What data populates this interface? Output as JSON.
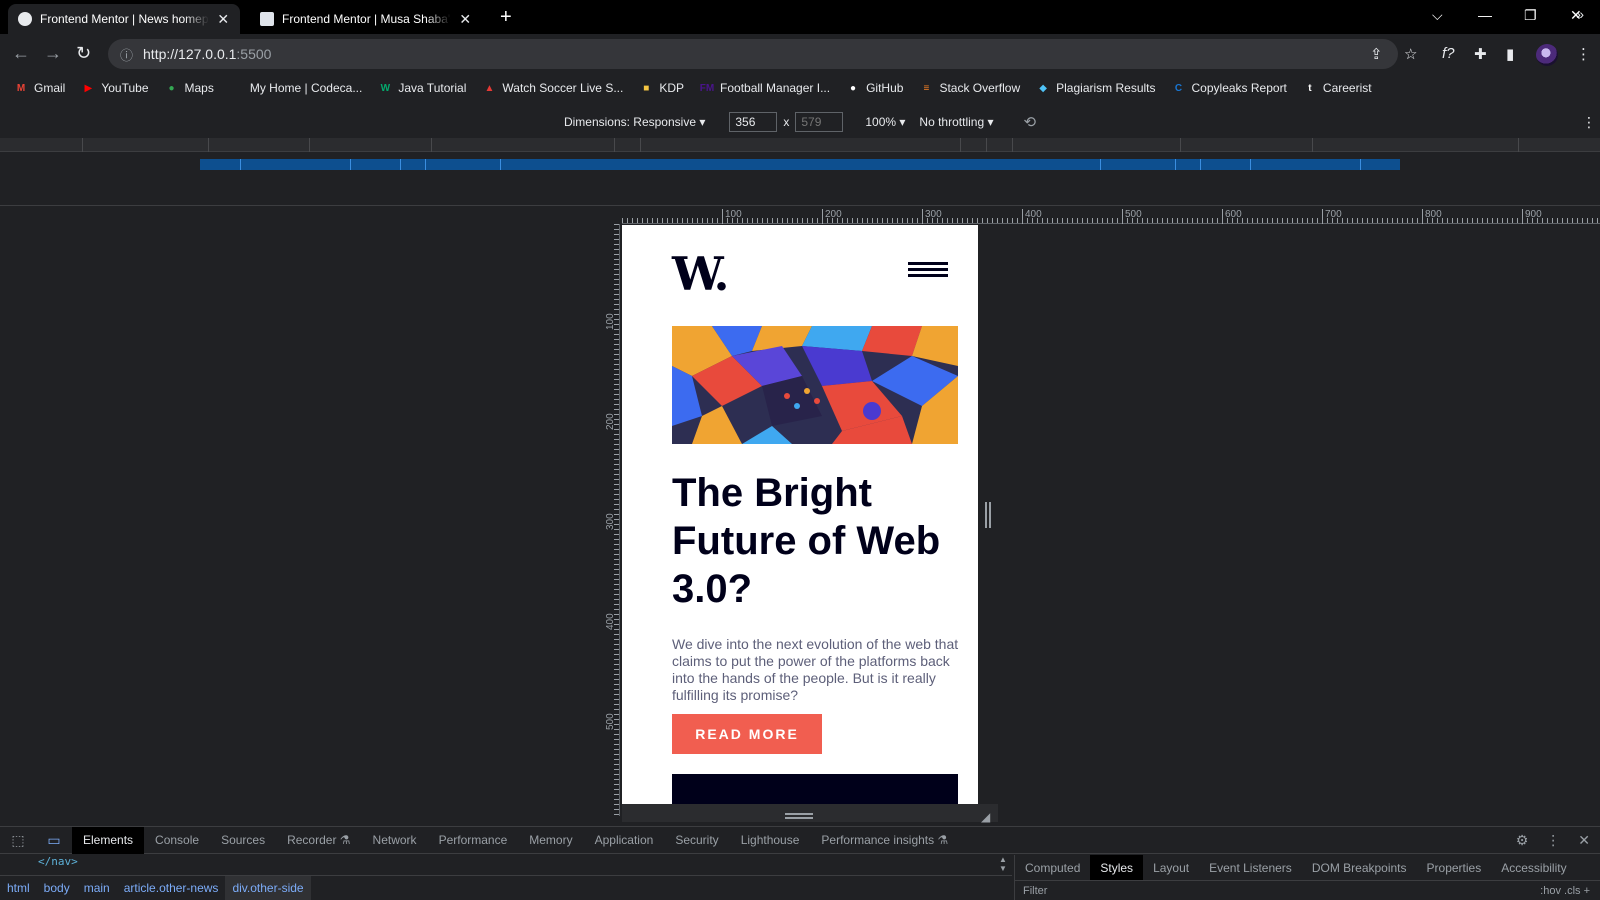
{
  "browser": {
    "tabs": [
      {
        "title": "Frontend Mentor | News homepage",
        "active": true
      },
      {
        "title": "Frontend Mentor | Musa Shaba's",
        "active": false
      }
    ],
    "new_tab": "+",
    "window_controls": {
      "dropdown": "⌵",
      "minimize": "—",
      "restore": "❐",
      "close": "✕"
    },
    "url_host": "http://127.0.0.1",
    "url_rest": ":5500",
    "bookmarks": [
      {
        "label": "Gmail",
        "icon": "gmail-icon",
        "glyph": "M",
        "color": "#ea4335"
      },
      {
        "label": "YouTube",
        "icon": "youtube-icon",
        "glyph": "▶",
        "color": "#ff0000"
      },
      {
        "label": "Maps",
        "icon": "maps-icon",
        "glyph": "●",
        "color": "#34a853"
      },
      {
        "label": "My Home | Codeca...",
        "icon": "codecademy-icon",
        "glyph": "",
        "color": "#1f2a3c"
      },
      {
        "label": "Java Tutorial",
        "icon": "w3schools-icon",
        "glyph": "W",
        "color": "#04aa6d"
      },
      {
        "label": "Watch Soccer Live S...",
        "icon": "soccer-icon",
        "glyph": "▲",
        "color": "#e53935"
      },
      {
        "label": "KDP",
        "icon": "folder-icon",
        "glyph": "■",
        "color": "#f4c542"
      },
      {
        "label": "Football Manager I...",
        "icon": "fm-icon",
        "glyph": "FM",
        "color": "#4a148c"
      },
      {
        "label": "GitHub",
        "icon": "github-icon",
        "glyph": "●",
        "color": "#ffffff"
      },
      {
        "label": "Stack Overflow",
        "icon": "stackoverflow-icon",
        "glyph": "≡",
        "color": "#f48024"
      },
      {
        "label": "Plagiarism Results",
        "icon": "plagiarism-icon",
        "glyph": "◆",
        "color": "#4fc3f7"
      },
      {
        "label": "Copyleaks Report",
        "icon": "copyleaks-icon",
        "glyph": "C",
        "color": "#1976d2"
      },
      {
        "label": "Careerist",
        "icon": "careerist-icon",
        "glyph": "t",
        "color": "#ffffff"
      }
    ],
    "bookmarks_more": "»"
  },
  "device_toolbar": {
    "dimensions_label": "Dimensions: Responsive ▾",
    "width": "356",
    "height_placeholder": "579",
    "times": "x",
    "zoom": "100% ▾",
    "throttling": "No throttling ▾",
    "rotate_icon": "rotate-icon",
    "more": "⋮"
  },
  "rulers": {
    "top_ticks": [
      "100",
      "200",
      "300",
      "400",
      "500",
      "600",
      "700",
      "800",
      "900"
    ],
    "left_ticks": [
      "100",
      "200",
      "300",
      "400",
      "500"
    ]
  },
  "page": {
    "logo": "W.",
    "heading": "The Bright Future of Web 3.0?",
    "paragraph": "We dive into the next evolution of the web that claims to put the power of the platforms back into the hands of the people. But is it really fulfilling its promise?",
    "button": "READ MORE",
    "colors": {
      "accent": "#f15e50",
      "dark": "#00001a",
      "text": "#5d5f79"
    }
  },
  "devtools": {
    "tabs": [
      "Elements",
      "Console",
      "Sources",
      "Recorder ⚗",
      "Network",
      "Performance",
      "Memory",
      "Application",
      "Security",
      "Lighthouse",
      "Performance insights ⚗"
    ],
    "active_tab": "Elements",
    "code_line": "</nav>",
    "breadcrumbs": [
      "html",
      "body",
      "main",
      "article.other-news",
      "div.other-side"
    ],
    "side_tabs": [
      "Computed",
      "Styles",
      "Layout",
      "Event Listeners",
      "DOM Breakpoints",
      "Properties",
      "Accessibility"
    ],
    "active_side_tab": "Styles",
    "filter_placeholder": "Filter",
    "filter_tools": ":hov  .cls  +"
  }
}
